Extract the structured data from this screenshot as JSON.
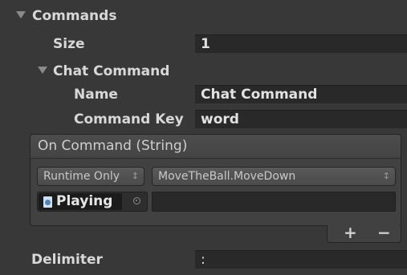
{
  "inspector": {
    "commands": {
      "label": "Commands",
      "size_label": "Size",
      "size_value": "1",
      "chat_command": {
        "label": "Chat Command",
        "name_label": "Name",
        "name_value": "Chat Command",
        "key_label": "Command Key",
        "key_value": "word"
      }
    },
    "event": {
      "header": "On Command (String)",
      "runtime_option": "Runtime Only",
      "function_option": "MoveTheBall.MoveDown",
      "target_object": "Playing",
      "argument_value": "",
      "add_label": "+",
      "remove_label": "−"
    },
    "delimiter": {
      "label": "Delimiter",
      "value": ":"
    }
  },
  "icons": {
    "foldout": "triangle-down-icon",
    "popup": "up-down-arrows-icon",
    "script": "script-icon",
    "picker": "object-picker-icon"
  },
  "colors": {
    "background": "#383838",
    "field": "#292929",
    "text": "#d8d8d8"
  }
}
